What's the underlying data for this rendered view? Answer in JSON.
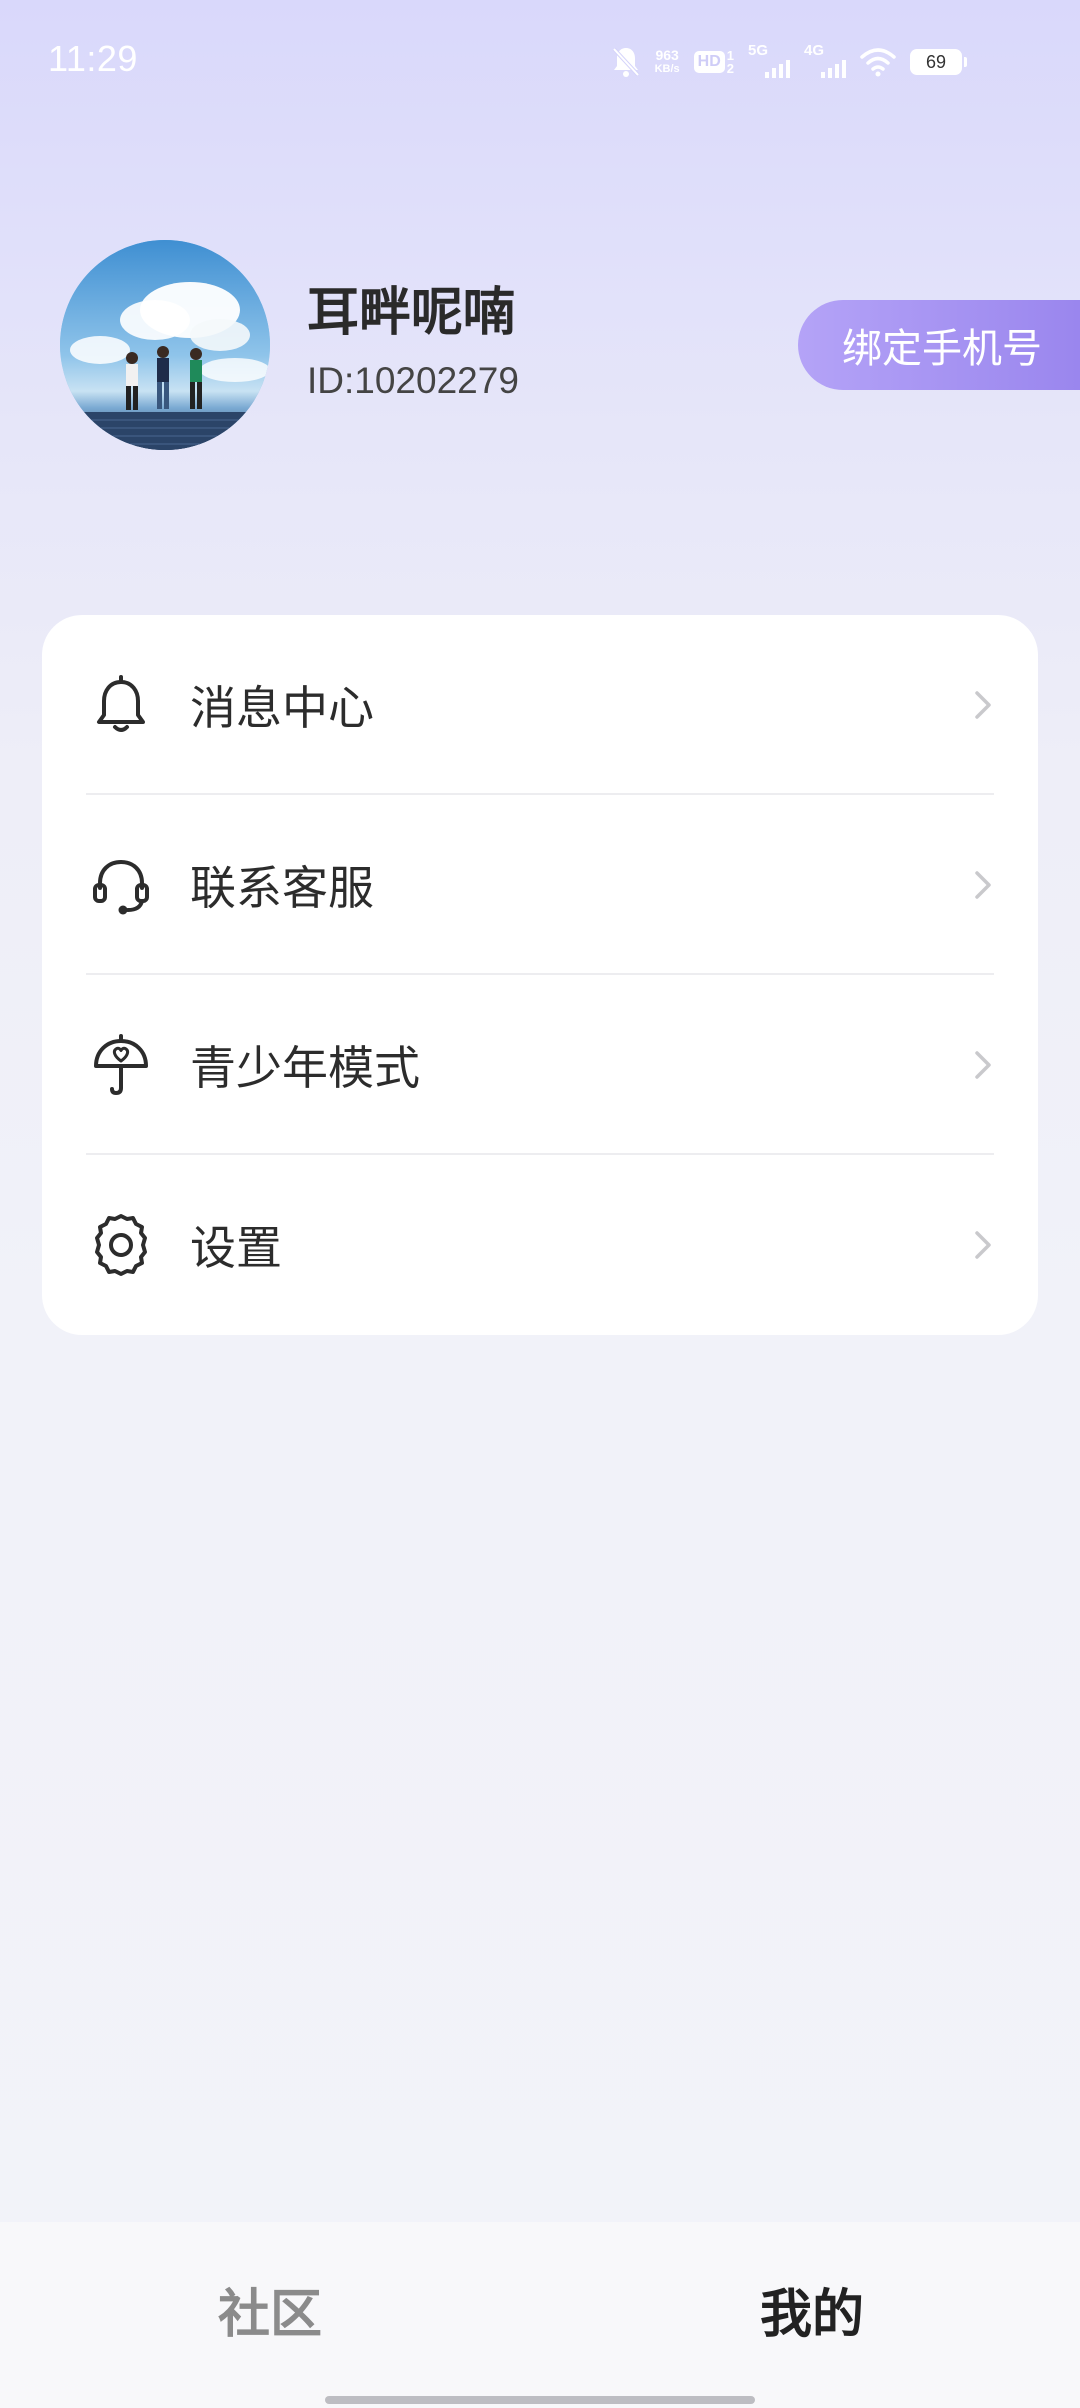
{
  "status_bar": {
    "time": "11:29",
    "net_speed_value": "963",
    "net_speed_unit": "KB/s",
    "hd_label": "HD",
    "hd_sup": "1",
    "hd_sub": "2",
    "network_1": "5G",
    "network_2": "4G",
    "battery": "69"
  },
  "profile": {
    "nickname": "耳畔呢喃",
    "user_id": "ID:10202279",
    "bind_phone_label": "绑定手机号"
  },
  "menu": {
    "items": [
      {
        "label": "消息中心",
        "icon": "bell-icon"
      },
      {
        "label": "联系客服",
        "icon": "headset-icon"
      },
      {
        "label": "青少年模式",
        "icon": "umbrella-heart-icon"
      },
      {
        "label": "设置",
        "icon": "gear-icon"
      }
    ]
  },
  "bottom_nav": {
    "tabs": [
      {
        "label": "社区",
        "active": false
      },
      {
        "label": "我的",
        "active": true
      }
    ]
  },
  "colors": {
    "accent_start": "#b4a3f7",
    "accent_end": "#9a86ee",
    "header_bg": "#d9d8fb",
    "page_bg": "#f2f3f9"
  }
}
